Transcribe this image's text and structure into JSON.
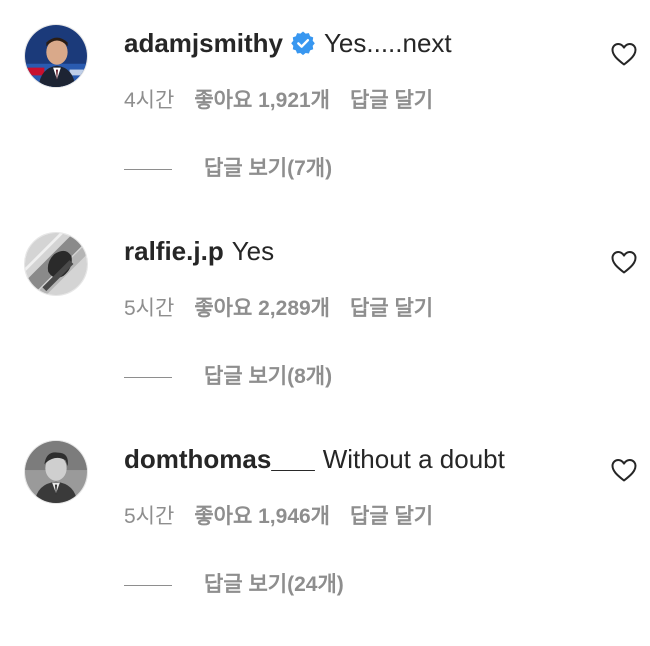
{
  "comments": [
    {
      "username": "adamjsmithy",
      "verified": true,
      "text": "Yes.....next",
      "time": "4시간",
      "likes": "좋아요 1,921개",
      "reply": "답글 달기",
      "view_replies": "답글 보기(7개)"
    },
    {
      "username": "ralfie.j.p",
      "verified": false,
      "text": "Yes",
      "time": "5시간",
      "likes": "좋아요 2,289개",
      "reply": "답글 달기",
      "view_replies": "답글 보기(8개)"
    },
    {
      "username": "domthomas___",
      "verified": false,
      "text": "Without a doubt",
      "time": "5시간",
      "likes": "좋아요 1,946개",
      "reply": "답글 달기",
      "view_replies": "답글 보기(24개)"
    }
  ],
  "colors": {
    "text": "#262626",
    "secondary": "#8e8e8e",
    "verified_badge": "#3897f0"
  },
  "icons": {
    "verified": "verified-badge-icon",
    "like": "heart-outline-icon"
  }
}
